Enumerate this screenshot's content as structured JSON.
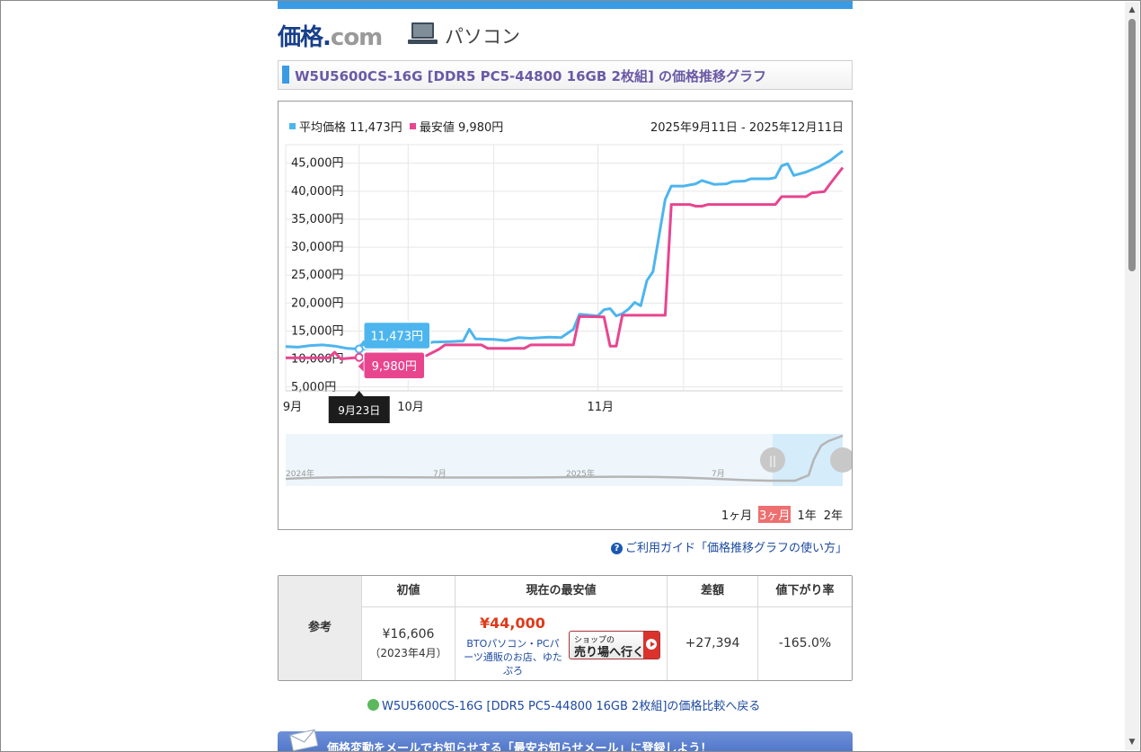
{
  "header": {
    "logo_part1": "価格",
    "logo_part2": ".",
    "logo_part3": "com",
    "category": "パソコン"
  },
  "page_title": "W5U5600CS-16G [DDR5 PC5-44800 16GB 2枚組] の価格推移グラフ",
  "legend": {
    "avg_label": "平均価格 11,473円",
    "min_label": "最安値 9,980円",
    "date_range": "2025年9月11日 - 2025年12月11日"
  },
  "colors": {
    "accent": "#3a9be5",
    "avg_series": "#4db5ee",
    "min_series": "#e8458f"
  },
  "tooltip": {
    "avg": "11,473円",
    "min": "9,980円",
    "date": "9月23日"
  },
  "navigator": {
    "labels": [
      "2024年",
      "7月",
      "2025年",
      "7月"
    ]
  },
  "range_buttons": [
    "1ヶ月",
    "3ヶ月",
    "1年",
    "2年"
  ],
  "range_selected": "3ヶ月",
  "chart_data": {
    "type": "line",
    "title": "",
    "xlabel": "",
    "ylabel": "",
    "x_ticks": [
      "9月",
      "10月",
      "11月"
    ],
    "y_ticks": [
      "5,000円",
      "10,000円",
      "15,000円",
      "20,000円",
      "25,000円",
      "30,000円",
      "35,000円",
      "40,000円",
      "45,000円"
    ],
    "ylim": [
      4000,
      48000
    ],
    "xlim": [
      "2025-09-11",
      "2025-12-11"
    ],
    "grid": true,
    "legend_position": "top-left",
    "series": [
      {
        "name": "平均価格",
        "color": "#4db5ee",
        "points": [
          [
            "2025-09-11",
            11900
          ],
          [
            "2025-09-13",
            11800
          ],
          [
            "2025-09-15",
            12100
          ],
          [
            "2025-09-17",
            12200
          ],
          [
            "2025-09-19",
            12000
          ],
          [
            "2025-09-21",
            11600
          ],
          [
            "2025-09-23",
            11473
          ],
          [
            "2025-09-26",
            11600
          ],
          [
            "2025-09-29",
            11500
          ],
          [
            "2025-10-01",
            11800
          ],
          [
            "2025-10-03",
            12000
          ],
          [
            "2025-10-05",
            12700
          ],
          [
            "2025-10-08",
            12800
          ],
          [
            "2025-10-10",
            12900
          ],
          [
            "2025-10-11",
            15000
          ],
          [
            "2025-10-12",
            13300
          ],
          [
            "2025-10-15",
            13200
          ],
          [
            "2025-10-17",
            13000
          ],
          [
            "2025-10-19",
            13500
          ],
          [
            "2025-10-21",
            13400
          ],
          [
            "2025-10-24",
            13600
          ],
          [
            "2025-10-26",
            13500
          ],
          [
            "2025-10-28",
            15000
          ],
          [
            "2025-10-29",
            17700
          ],
          [
            "2025-11-01",
            17400
          ],
          [
            "2025-11-02",
            18500
          ],
          [
            "2025-11-03",
            18700
          ],
          [
            "2025-11-04",
            17400
          ],
          [
            "2025-11-05",
            17800
          ],
          [
            "2025-11-06",
            18600
          ],
          [
            "2025-11-07",
            19800
          ],
          [
            "2025-11-08",
            19200
          ],
          [
            "2025-11-09",
            23700
          ],
          [
            "2025-11-10",
            25300
          ],
          [
            "2025-11-12",
            38200
          ],
          [
            "2025-11-13",
            40600
          ],
          [
            "2025-11-15",
            40600
          ],
          [
            "2025-11-17",
            41000
          ],
          [
            "2025-11-18",
            41600
          ],
          [
            "2025-11-20",
            40900
          ],
          [
            "2025-11-22",
            41000
          ],
          [
            "2025-11-23",
            41400
          ],
          [
            "2025-11-25",
            41500
          ],
          [
            "2025-11-26",
            41900
          ],
          [
            "2025-11-29",
            41900
          ],
          [
            "2025-11-30",
            42100
          ],
          [
            "2025-12-01",
            44200
          ],
          [
            "2025-12-02",
            44600
          ],
          [
            "2025-12-03",
            42500
          ],
          [
            "2025-12-05",
            43100
          ],
          [
            "2025-12-07",
            44000
          ],
          [
            "2025-12-09",
            45200
          ],
          [
            "2025-12-11",
            46900
          ]
        ]
      },
      {
        "name": "最安値",
        "color": "#e8458f",
        "points": [
          [
            "2025-09-11",
            9900
          ],
          [
            "2025-09-18",
            9900
          ],
          [
            "2025-09-19",
            10900
          ],
          [
            "2025-09-20",
            9700
          ],
          [
            "2025-09-23",
            9980
          ],
          [
            "2025-10-01",
            9980
          ],
          [
            "2025-10-04",
            10300
          ],
          [
            "2025-10-06",
            11400
          ],
          [
            "2025-10-07",
            12200
          ],
          [
            "2025-10-13",
            12200
          ],
          [
            "2025-10-14",
            11600
          ],
          [
            "2025-10-20",
            11600
          ],
          [
            "2025-10-21",
            12200
          ],
          [
            "2025-10-28",
            12200
          ],
          [
            "2025-10-29",
            17300
          ],
          [
            "2025-11-02",
            17200
          ],
          [
            "2025-11-03",
            12000
          ],
          [
            "2025-11-04",
            12000
          ],
          [
            "2025-11-05",
            17500
          ],
          [
            "2025-11-12",
            17500
          ],
          [
            "2025-11-13",
            37300
          ],
          [
            "2025-11-16",
            37300
          ],
          [
            "2025-11-17",
            37000
          ],
          [
            "2025-11-18",
            37000
          ],
          [
            "2025-11-19",
            37300
          ],
          [
            "2025-11-30",
            37300
          ],
          [
            "2025-12-01",
            38700
          ],
          [
            "2025-12-05",
            38700
          ],
          [
            "2025-12-06",
            39400
          ],
          [
            "2025-12-08",
            39600
          ],
          [
            "2025-12-09",
            41100
          ],
          [
            "2025-12-11",
            43900
          ]
        ]
      }
    ]
  },
  "guide_link": "ご利用ガイド「価格推移グラフの使い方」",
  "ref_table": {
    "row_label": "参考",
    "headers": [
      "初値",
      "現在の最安値",
      "差額",
      "値下がり率"
    ],
    "initial_price": "¥16,606",
    "initial_date": "（2023年4月）",
    "current_lowest": "¥44,000",
    "shop_name": "BTOパソコン・PCパーツ通販のお店、ゆたぷろ",
    "shop_button_small": "ショップの",
    "shop_button_main": "売り場へ行く",
    "diff": "+27,394",
    "drop_rate": "-165.0%"
  },
  "back_link": "W5U5600CS-16G [DDR5 PC5-44800 16GB 2枚組]の価格比較へ戻る",
  "mail_banner": "価格変動をメールでお知らせする「最安お知らせメール」に登録しよう！"
}
